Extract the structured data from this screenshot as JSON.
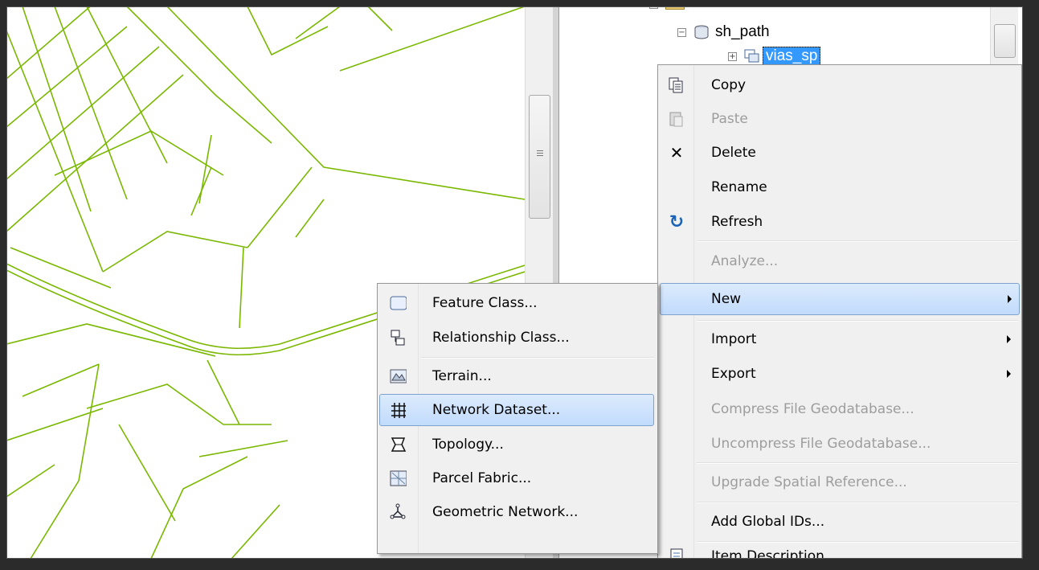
{
  "catalog": {
    "tree": [
      {
        "label": "sh_path",
        "expander": "⊟",
        "icon": "database-icon"
      },
      {
        "label": "vias_sp",
        "expander": "⊞",
        "icon": "feature-dataset-icon",
        "selected": true
      }
    ]
  },
  "context_menu": {
    "items": [
      {
        "label": "Copy",
        "icon": "copy-icon",
        "enabled": true
      },
      {
        "label": "Paste",
        "icon": "paste-icon",
        "enabled": false
      },
      {
        "label": "Delete",
        "icon": "delete-icon",
        "enabled": true
      },
      {
        "label": "Rename",
        "icon": "",
        "enabled": true
      },
      {
        "label": "Refresh",
        "icon": "refresh-icon",
        "enabled": true
      },
      {
        "label": "Analyze...",
        "icon": "",
        "enabled": false
      },
      {
        "label": "New",
        "icon": "",
        "enabled": true,
        "submenu": true,
        "highlighted": true
      },
      {
        "label": "Import",
        "icon": "",
        "enabled": true,
        "submenu": true
      },
      {
        "label": "Export",
        "icon": "",
        "enabled": true,
        "submenu": true
      },
      {
        "label": "Compress File Geodatabase...",
        "icon": "",
        "enabled": false
      },
      {
        "label": "Uncompress File Geodatabase...",
        "icon": "",
        "enabled": false
      },
      {
        "label": "Upgrade Spatial Reference...",
        "icon": "",
        "enabled": false
      },
      {
        "label": "Add Global IDs...",
        "icon": "",
        "enabled": true
      },
      {
        "label": "Item Description...",
        "icon": "item-description-icon",
        "enabled": true
      }
    ]
  },
  "new_submenu": {
    "items": [
      {
        "label": "Feature Class...",
        "icon": "feature-class-icon"
      },
      {
        "label": "Relationship Class...",
        "icon": "relationship-class-icon"
      },
      {
        "label": "Terrain...",
        "icon": "terrain-icon"
      },
      {
        "label": "Network Dataset...",
        "icon": "network-dataset-icon",
        "highlighted": true
      },
      {
        "label": "Topology...",
        "icon": "topology-icon"
      },
      {
        "label": "Parcel Fabric...",
        "icon": "parcel-fabric-icon"
      },
      {
        "label": "Geometric Network...",
        "icon": "geometric-network-icon"
      }
    ]
  },
  "colors": {
    "map_lines": "#7ab800",
    "highlight": "#c1dbfc"
  }
}
